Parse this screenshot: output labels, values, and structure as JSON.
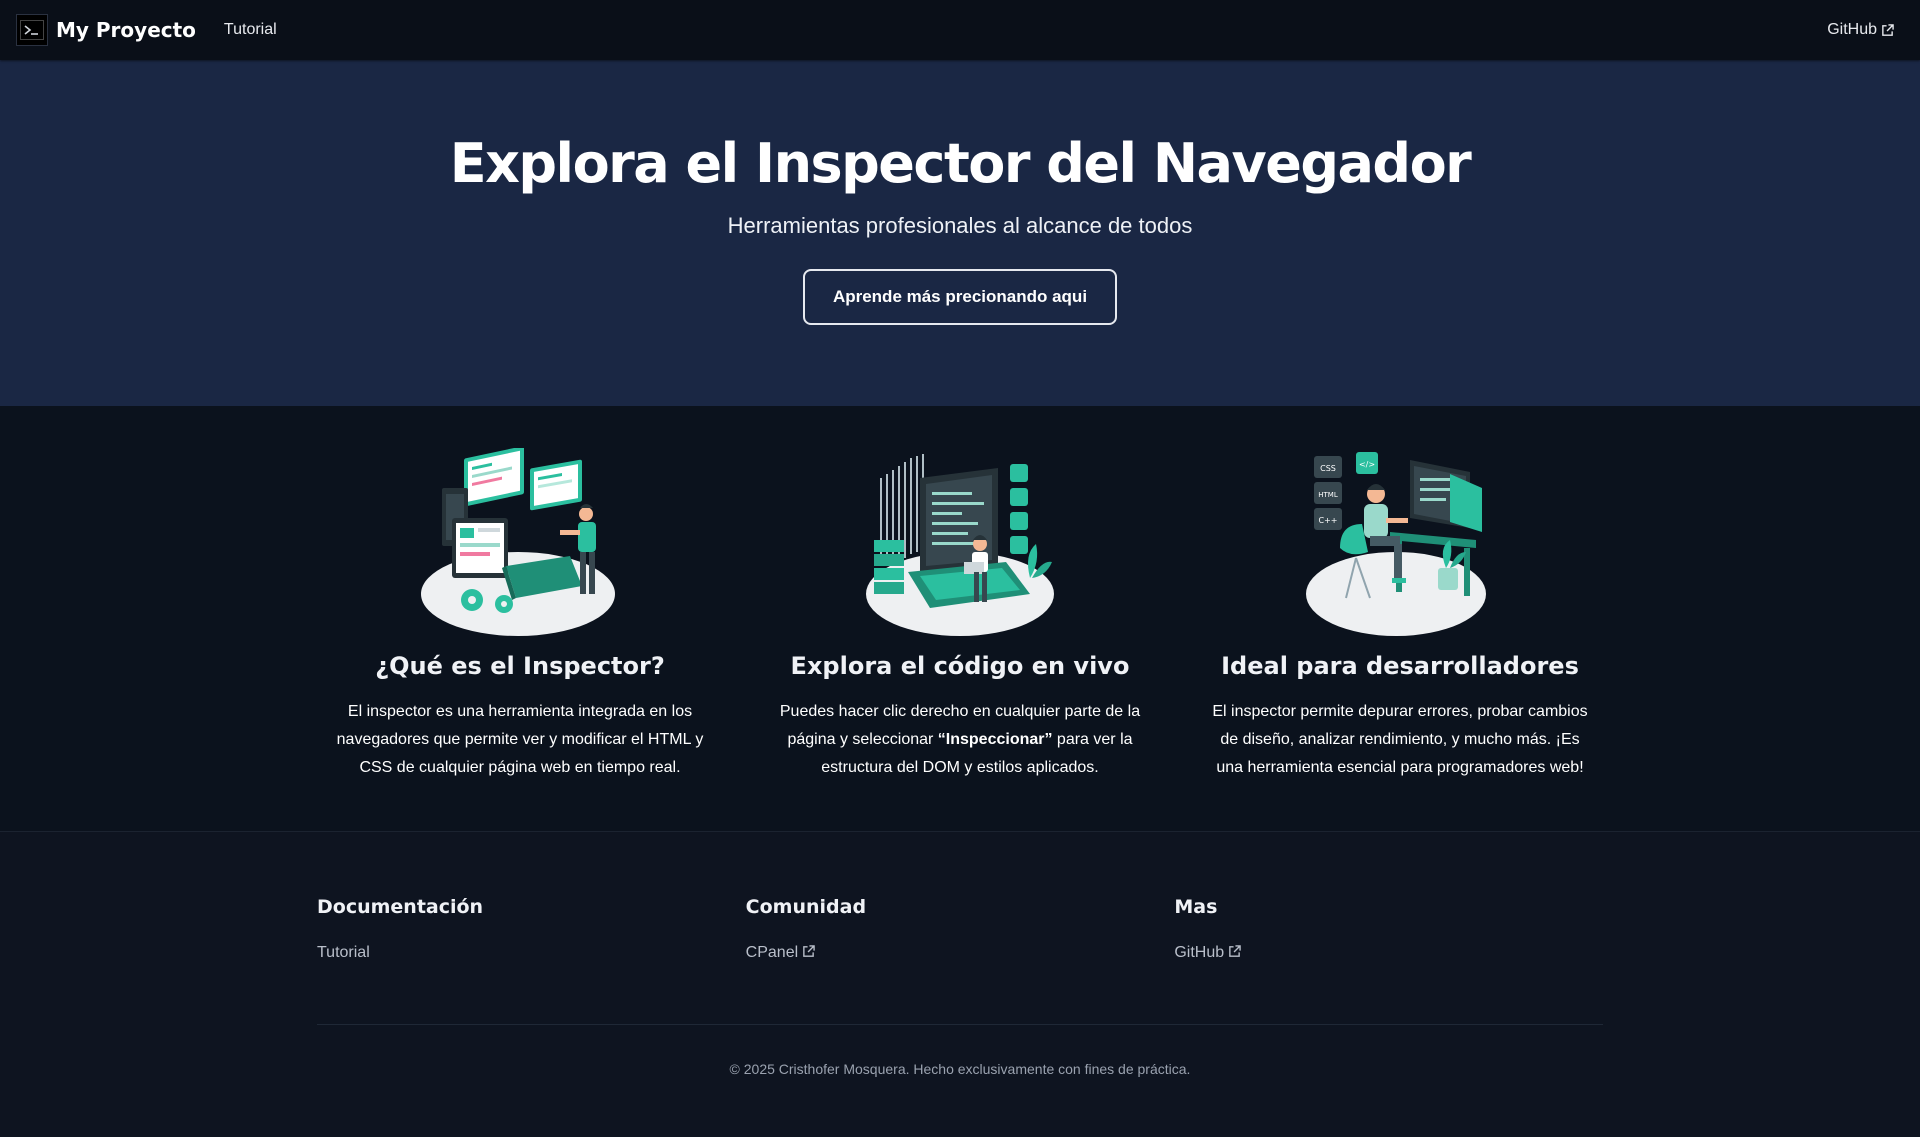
{
  "navbar": {
    "brand_title": "My Proyecto",
    "tutorial_link": "Tutorial",
    "github_link": "GitHub"
  },
  "hero": {
    "title": "Explora el Inspector del Navegador",
    "subtitle": "Herramientas profesionales al alcance de todos",
    "button_label": "Aprende más precionando aqui"
  },
  "features": [
    {
      "illustration": "developer-dashboard-illustration",
      "title": "¿Qué es el Inspector?",
      "text": "El inspector es una herramienta integrada en los navegadores que permite ver y modificar el HTML y CSS de cualquier página web en tiempo real."
    },
    {
      "illustration": "laptop-code-illustration",
      "title": "Explora el código en vivo",
      "text_before": "Puedes hacer clic derecho en cualquier parte de la página y seleccionar ",
      "text_bold": "“Inspeccionar”",
      "text_after": " para ver la estructura del DOM y estilos aplicados."
    },
    {
      "illustration": "programmer-desk-illustration",
      "title": "Ideal para desarrolladores",
      "text": "El inspector permite depurar errores, probar cambios de diseño, analizar rendimiento, y mucho más. ¡Es una herramienta esencial para programadores web!"
    }
  ],
  "footer": {
    "columns": [
      {
        "heading": "Documentación",
        "link": "Tutorial",
        "external": false
      },
      {
        "heading": "Comunidad",
        "link": "CPanel",
        "external": true
      },
      {
        "heading": "Mas",
        "link": "GitHub",
        "external": true
      }
    ],
    "copyright": "© 2025 Cristhofer Mosquera. Hecho exclusivamente con fines de práctica."
  },
  "colors": {
    "navbar_bg": "#0a0f18",
    "hero_bg": "#1a2744",
    "page_bg": "#0b121d",
    "footer_bg": "#0e1420",
    "accent": "#2bbf9f"
  }
}
